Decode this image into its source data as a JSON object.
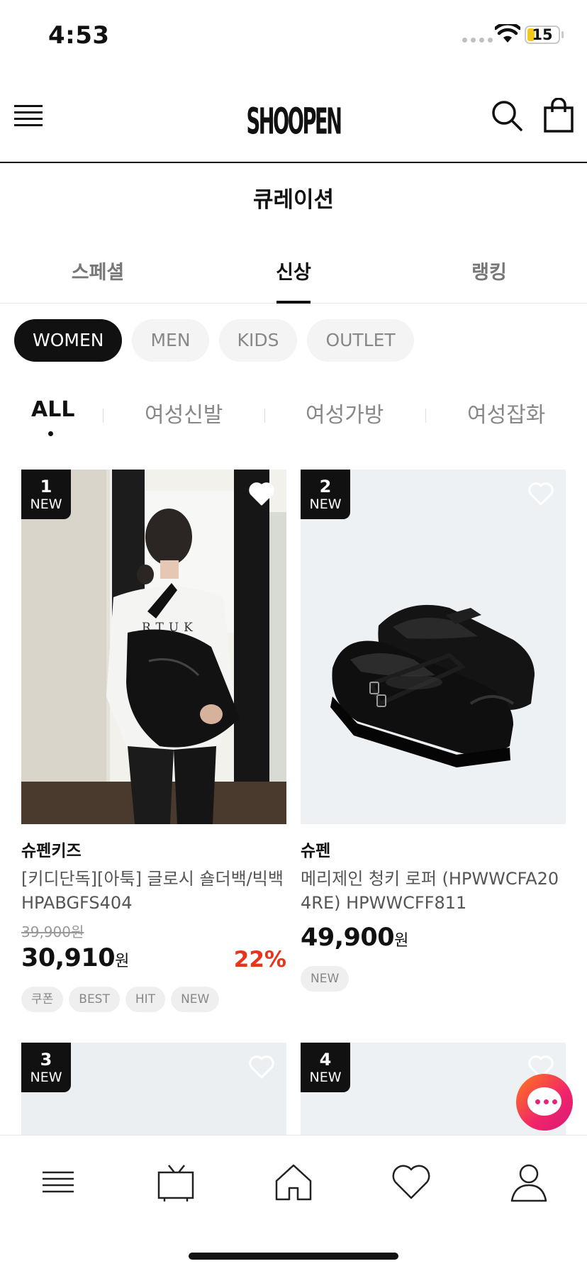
{
  "status_bar": {
    "time": "4:53",
    "battery": "15"
  },
  "header": {
    "logo_text": "SHOOPEN"
  },
  "page_title": "큐레이션",
  "tabs": [
    {
      "label": "스페셜",
      "active": false
    },
    {
      "label": "신상",
      "active": true
    },
    {
      "label": "랭킹",
      "active": false
    }
  ],
  "gender_chips": [
    {
      "label": "WOMEN",
      "active": true
    },
    {
      "label": "MEN",
      "active": false
    },
    {
      "label": "KIDS",
      "active": false
    },
    {
      "label": "OUTLET",
      "active": false
    }
  ],
  "categories": [
    {
      "label": "ALL",
      "active": true
    },
    {
      "label": "여성신발",
      "active": false
    },
    {
      "label": "여성가방",
      "active": false
    },
    {
      "label": "여성잡화",
      "active": false
    }
  ],
  "products": [
    {
      "rank": "1",
      "rank_tag": "NEW",
      "brand": "슈펜키즈",
      "name": "[키디단독][아툭] 글로시 숄더백/빅백 HPABGFS404",
      "original_price": "39,900원",
      "price": "30,910",
      "currency": "원",
      "discount": "22%",
      "badges": [
        "쿠폰",
        "BEST",
        "HIT",
        "NEW"
      ],
      "image": "person-with-black-bag-photo",
      "shirt_text": "RTUK",
      "wishlisted": true
    },
    {
      "rank": "2",
      "rank_tag": "NEW",
      "brand": "슈펜",
      "name": "메리제인 청키 로퍼 (HPWWCFA204RE) HPWWCFF811",
      "original_price": "",
      "price": "49,900",
      "currency": "원",
      "discount": "",
      "badges": [
        "NEW"
      ],
      "image": "black-mary-jane-loafers-photo",
      "wishlisted": false
    },
    {
      "rank": "3",
      "rank_tag": "NEW"
    },
    {
      "rank": "4",
      "rank_tag": "NEW"
    }
  ],
  "colors": {
    "accent": "#111111",
    "discount": "#e8341c",
    "chip_bg": "#f4f4f4"
  },
  "icons": {
    "header": [
      "menu-icon",
      "search-icon",
      "shopping-bag-icon"
    ],
    "bottom_nav": [
      "menu-icon",
      "tv-icon",
      "home-icon",
      "heart-icon",
      "user-icon"
    ],
    "fab": "chat-icon"
  }
}
